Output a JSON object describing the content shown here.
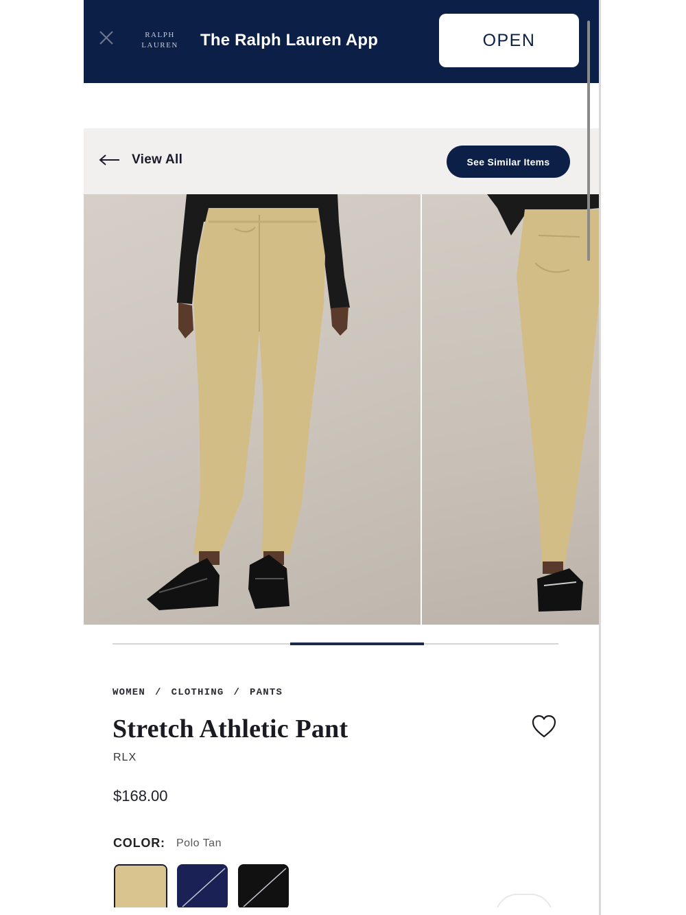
{
  "banner": {
    "logo_line1": "RALPH",
    "logo_line2": "LAUREN",
    "title": "The Ralph Lauren App",
    "open_label": "OPEN",
    "background": "#0b1f47"
  },
  "nav": {
    "back_label": "View All",
    "similar_label": "See Similar Items"
  },
  "gallery": {
    "active_index": 1,
    "total": 3
  },
  "breadcrumb": [
    "WOMEN",
    "/",
    "CLOTHING",
    "/",
    "PANTS"
  ],
  "product": {
    "title": "Stretch Athletic Pant",
    "brand": "RLX",
    "price": "$168.00"
  },
  "color": {
    "label": "COLOR:",
    "selected": "Polo Tan",
    "swatches": [
      {
        "name": "polo-tan",
        "hex": "#d9c38f",
        "selected": true
      },
      {
        "name": "navy",
        "hex": "#1a2255",
        "selected": false
      },
      {
        "name": "black",
        "hex": "#111111",
        "selected": false
      }
    ]
  },
  "icons": {
    "close": "close-icon",
    "back": "arrow-left-icon",
    "wishlist": "heart-icon"
  }
}
